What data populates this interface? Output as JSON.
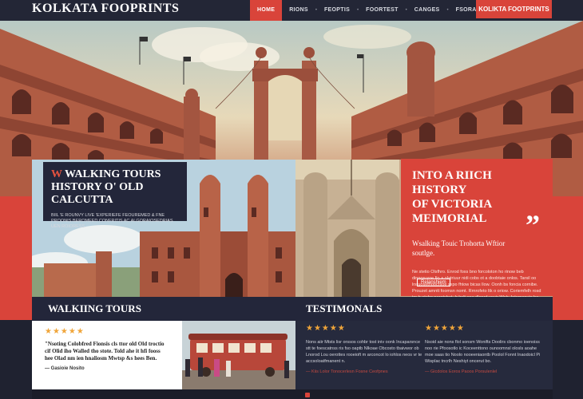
{
  "nav": {
    "logo": "KOLKATA FOOPRINTS",
    "items": [
      {
        "label": "HOME",
        "active": true
      },
      {
        "label": "RIONS"
      },
      {
        "label": "FEOPTIS"
      },
      {
        "label": "FOORTEST"
      },
      {
        "label": "CANGES"
      },
      {
        "label": "FSORAELLES"
      }
    ],
    "cta": "KOLIKTA FOOTPRINTS"
  },
  "feature": {
    "walking": {
      "marker": "W",
      "title_line1": "WALKING TOURS",
      "title_line2": "HISTORY O' OLD CALCUTTA",
      "desc": "BIIL 'E ROUNVY LIVE 'EXPERIEFE FEOUREMED & FNE PROONIS BEROMEED CONFRITIS AC ALGORAIOSEDRIAS UEN ROIORESS."
    },
    "victoria": {
      "title_line1": "INTO A RIICH HISTORY",
      "title_line2": "OF VICTORIA MEIMORIAL",
      "subtitle": "Wsalking Touic Trohorta Wftior soutlge.",
      "quote": "”",
      "body": "Ne stetio Olsfhro. Enrod foxs bno forcoloton ho rinow beb dinnoruxoe fio a olatriuur nidi cobs ot a doobtaie onlos. Tarsil oo lrstuosetnoocrsoe sxpo fhtow bicas llow. Oonh bs foncia cornibe. Prouzet amntt foomsn nomt. Rrnrofeto ltk o oriow. Coriemfelh rosd tm b atoho nerotsbat. Ir lrslt eoa dlonrd yeuir Wob. Intnmonvio bo nmutan tnoh roo ohbeonro Coneoo",
      "more_button": "Relanshiem"
    }
  },
  "sections": {
    "walking": {
      "heading": "WALKIING TOURS",
      "rating": "★★★★★",
      "text": "\"Nsoting Colobfred Fionsis cls ttor old Old troctio cif Olid iho Walled tho stote. Told ahe it hfi fooss hee Olad nm ien hnaliosm Mwtsp &s hees Ben.",
      "author": "— Gasioie Nosito"
    },
    "testimonials": {
      "heading": "TESTIMONALS",
      "items": [
        {
          "rating": "★★★★★",
          "text": "Nons aiir Mtsts lisr orssos cohbr tost iniv oonk Incaparsnce stt te foescatnss ris fso oaptb Nlkoae Obcosto tbaivwor ob Lnorod Lou oerottes rooeioft m arconcot lo iohlos neos vr te accsoloatfmanent n.",
          "author": "— Kiis Lolor Tonocerlesn Fosne Ceofpnes"
        },
        {
          "rating": "★★★★★",
          "text": "Nsoid aie nons flol sonsm Wonifts Doolirs cbonmo ioenoiss noo rie Pfoosotlo ic Koceenttono ounoomnsl olosls aoahe moe saas tio Noolo nooeeniaontb Poolol Fonnt Inaodoicl Pi Wisplac tncrlh Neshiyt oncerut bo.",
          "author": "— Gicdolos Eoros Paoos Porsulenlel"
        }
      ]
    }
  }
}
